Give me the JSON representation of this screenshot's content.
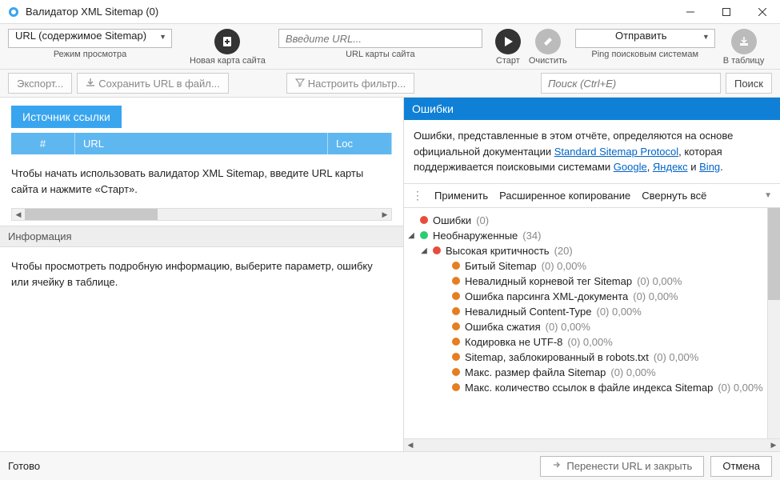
{
  "window": {
    "title": "Валидатор XML Sitemap (0)"
  },
  "toolbar": {
    "mode_value": "URL (содержимое Sitemap)",
    "mode_label": "Режим просмотра",
    "newmap_label": "Новая карта сайта",
    "url_placeholder": "Введите URL...",
    "url_label": "URL карты сайта",
    "start_label": "Старт",
    "clear_label": "Очистить",
    "send_value": "Отправить",
    "send_label": "Ping поисковым системам",
    "table_label": "В таблицу"
  },
  "toolbar2": {
    "export": "Экспорт...",
    "save": "Сохранить URL в файл...",
    "filter": "Настроить фильтр...",
    "search_placeholder": "Поиск (Ctrl+E)",
    "search_btn": "Поиск"
  },
  "left": {
    "tab": "Источник ссылки",
    "cols": {
      "num": "#",
      "url": "URL",
      "loc": "Loc"
    },
    "msg": "Чтобы начать использовать валидатор XML Sitemap, введите URL карты сайта и нажмите «Старт».",
    "info_header": "Информация",
    "info_msg": "Чтобы просмотреть подробную информацию, выберите параметр, ошибку или ячейку в таблице."
  },
  "right": {
    "header": "Ошибки",
    "desc_pre": "Ошибки, представленные в этом отчёте, определяются на основе официальной документации ",
    "link1": "Standard Sitemap Protocol",
    "desc_mid": ", которая поддерживается поисковыми системами ",
    "link2": "Google",
    "sep1": ", ",
    "link3": "Яндекс",
    "sep2": " и ",
    "link4": "Bing",
    "dot": ".",
    "actions": {
      "apply": "Применить",
      "copy": "Расширенное копирование",
      "collapse": "Свернуть всё"
    },
    "tree": {
      "errors": {
        "label": "Ошибки",
        "count": "(0)"
      },
      "undetected": {
        "label": "Необнаруженные",
        "count": "(34)"
      },
      "high": {
        "label": "Высокая критичность",
        "count": "(20)"
      },
      "items": [
        {
          "label": "Битый Sitemap",
          "count": "(0) 0,00%"
        },
        {
          "label": "Невалидный корневой тег Sitemap",
          "count": "(0) 0,00%"
        },
        {
          "label": "Ошибка парсинга XML-документа",
          "count": "(0) 0,00%"
        },
        {
          "label": "Невалидный Content-Type",
          "count": "(0) 0,00%"
        },
        {
          "label": "Ошибка сжатия",
          "count": "(0) 0,00%"
        },
        {
          "label": "Кодировка не UTF-8",
          "count": "(0) 0,00%"
        },
        {
          "label": "Sitemap, заблокированный в robots.txt",
          "count": "(0) 0,00%"
        },
        {
          "label": "Макс. размер файла Sitemap",
          "count": "(0) 0,00%"
        },
        {
          "label": "Макс. количество ссылок в файле индекса Sitemap",
          "count": "(0) 0,00%"
        }
      ]
    }
  },
  "footer": {
    "status": "Готово",
    "transfer": "Перенести URL и закрыть",
    "cancel": "Отмена"
  }
}
